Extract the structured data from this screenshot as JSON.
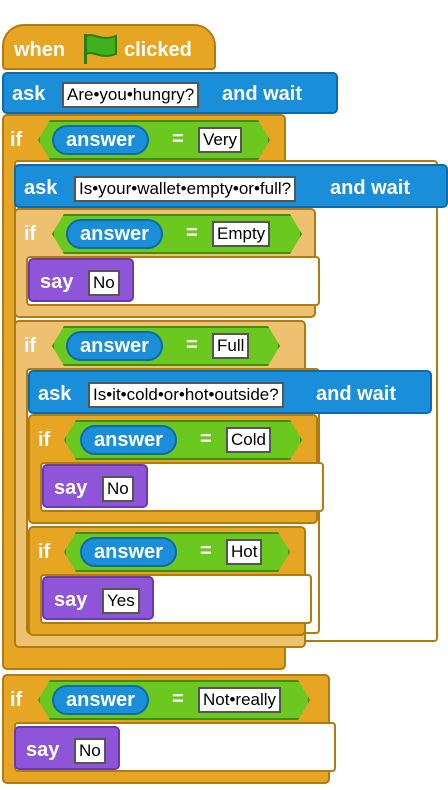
{
  "colors": {
    "control": "#e6a523",
    "sensing": "#1a8ed8",
    "looks": "#8f55d8",
    "operators": "#6bc81f"
  },
  "hat": {
    "when": "when",
    "clicked": "clicked",
    "icon": "green-flag-icon"
  },
  "ask1": {
    "ask": "ask",
    "question": "Are•you•hungry?",
    "and_wait": "and wait"
  },
  "if1": {
    "if": "if",
    "answer": "answer",
    "eq": "=",
    "value": "Very"
  },
  "ask2": {
    "ask": "ask",
    "question": "Is•your•wallet•empty•or•full?",
    "and_wait": "and wait"
  },
  "if2": {
    "if": "if",
    "answer": "answer",
    "eq": "=",
    "value": "Empty"
  },
  "say1": {
    "say": "say",
    "text": "No"
  },
  "if3": {
    "if": "if",
    "answer": "answer",
    "eq": "=",
    "value": "Full"
  },
  "ask3": {
    "ask": "ask",
    "question": "Is•it•cold•or•hot•outside?",
    "and_wait": "and wait"
  },
  "if4": {
    "if": "if",
    "answer": "answer",
    "eq": "=",
    "value": "Cold"
  },
  "say2": {
    "say": "say",
    "text": "No"
  },
  "if5": {
    "if": "if",
    "answer": "answer",
    "eq": "=",
    "value": "Hot"
  },
  "say3": {
    "say": "say",
    "text": "Yes"
  },
  "if6": {
    "if": "if",
    "answer": "answer",
    "eq": "=",
    "value": "Not•really"
  },
  "say4": {
    "say": "say",
    "text": "No"
  }
}
